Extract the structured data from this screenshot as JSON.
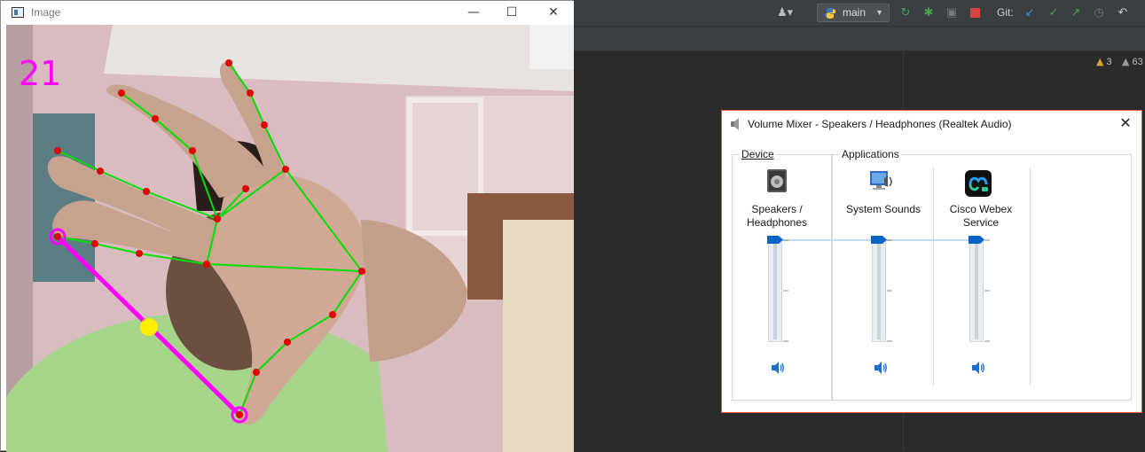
{
  "ide": {
    "branch": "main",
    "git_label": "Git:",
    "warnings": [
      {
        "count": "3",
        "color": "#e0a030"
      },
      {
        "count": "63",
        "color": "#9a9a9a"
      }
    ],
    "toolbar_icons": [
      "user-icon",
      "python-icon",
      "rerun-icon",
      "debug-icon",
      "coverage-icon",
      "stop-icon",
      "git-update-icon",
      "git-commit-icon",
      "git-push-icon",
      "history-icon",
      "rollback-icon"
    ]
  },
  "image_window": {
    "title": "Image",
    "overlay_value": "21",
    "overlay_color": "#ff00ff",
    "controls": [
      "—",
      "☐",
      "✕"
    ],
    "landmark_color": "#e00000",
    "skeleton_color": "#00e000",
    "pinch_line_color": "#ff00ff",
    "midpoint_color": "#ffee00"
  },
  "mixer": {
    "title": "Volume Mixer - Speakers / Headphones (Realtek Audio)",
    "device_group_label": "Device",
    "applications_group_label": "Applications",
    "channels": [
      {
        "name": "Speakers / Headphones",
        "icon": "speaker-device-icon",
        "level": 1.0
      },
      {
        "name": "System Sounds",
        "icon": "system-sounds-icon",
        "level": 1.0
      },
      {
        "name": "Cisco Webex Service",
        "icon": "webex-icon",
        "level": 1.0
      }
    ],
    "accent": "#0a64c8"
  }
}
